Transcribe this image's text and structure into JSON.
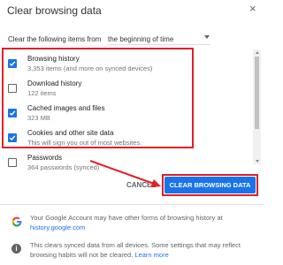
{
  "dialog": {
    "title": "Clear browsing data",
    "close_glyph": "×"
  },
  "time_range": {
    "label": "Clear the following items from",
    "value": "the beginning of time"
  },
  "items": [
    {
      "label": "Browsing history",
      "desc": "3,353 items (and more on synced devices)",
      "checked": true
    },
    {
      "label": "Download history",
      "desc": "122 items",
      "checked": false
    },
    {
      "label": "Cached images and files",
      "desc": "323 MB",
      "checked": true
    },
    {
      "label": "Cookies and other site data",
      "desc": "This will sign you out of most websites.",
      "checked": true
    },
    {
      "label": "Passwords",
      "desc": "364 passwords (synced)",
      "checked": false
    }
  ],
  "buttons": {
    "cancel": "CANCEL",
    "clear": "CLEAR BROWSING DATA"
  },
  "footer": {
    "line1": "Your Google Account may have other forms of browsing history at",
    "line1_link": "history.google.com",
    "line2": "This clears synced data from all devices. Some settings that may reflect",
    "line2b": "browsing habits will not be cleared.",
    "line2_link": "Learn more"
  },
  "colors": {
    "accent": "#1a73e8",
    "annotation_red": "#e0202b"
  },
  "icons": {
    "google": "google-g-icon",
    "info": "info-icon"
  }
}
